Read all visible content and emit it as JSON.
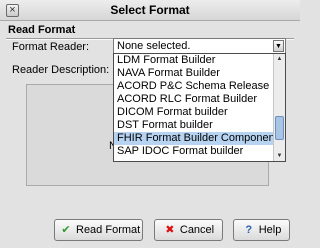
{
  "window": {
    "title": "Select Format",
    "close_glyph": "×"
  },
  "section_title": "Read Format",
  "fields": {
    "reader_label": "Format Reader:",
    "reader_value": "None selected.",
    "description_label": "Reader Description:",
    "description_text": "No"
  },
  "dropdown": {
    "items": [
      "LDM Format Builder",
      "NAVA Format Builder",
      "ACORD P&C Schema Release",
      "ACORD RLC Format Builder",
      "DICOM Format builder",
      "DST Format builder",
      "FHIR Format Builder Component",
      "SAP IDOC Format builder"
    ],
    "selected_index": 6
  },
  "buttons": {
    "read_label": "Read Format",
    "cancel_label": "Cancel",
    "help_label": "Help"
  },
  "icons": {
    "check": "✔",
    "cancel": "✖",
    "help": "?",
    "scroll_up": "▲",
    "scroll_down": "▼",
    "combo_arrow": "▼"
  },
  "colors": {
    "selection": "#b6d4f2",
    "scroll_thumb": "#a8c5e6"
  }
}
